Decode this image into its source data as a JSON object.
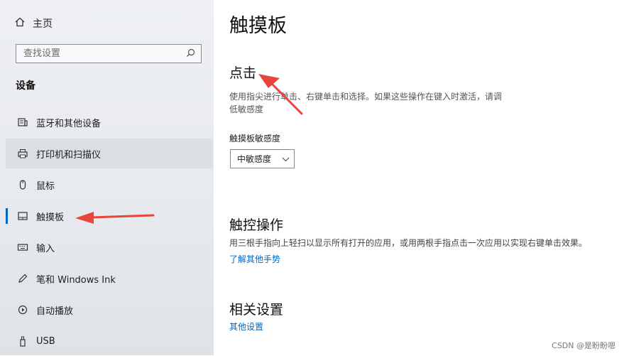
{
  "sidebar": {
    "home_label": "主页",
    "search_placeholder": "查找设置",
    "section_title": "设备",
    "items": [
      {
        "label": "蓝牙和其他设备",
        "icon": "bluetooth-devices-icon"
      },
      {
        "label": "打印机和扫描仪",
        "icon": "printer-icon"
      },
      {
        "label": "鼠标",
        "icon": "mouse-icon"
      },
      {
        "label": "触摸板",
        "icon": "touchpad-icon"
      },
      {
        "label": "输入",
        "icon": "keyboard-icon"
      },
      {
        "label": "笔和 Windows Ink",
        "icon": "pen-icon"
      },
      {
        "label": "自动播放",
        "icon": "autoplay-icon"
      },
      {
        "label": "USB",
        "icon": "usb-icon"
      }
    ]
  },
  "main": {
    "title": "触摸板",
    "tap": {
      "heading": "点击",
      "description_line1": "使用指尖进行单击、右键单击和选择。如果这些操作在键入时激活，请调",
      "description_line2": "低敏感度",
      "sensitivity_label": "触摸板敏感度",
      "sensitivity_value": "中敏感度"
    },
    "gestures": {
      "heading": "触控操作",
      "description": "用三根手指向上轻扫以显示所有打开的应用，或用两根手指点击一次应用以实现右键单击效果。",
      "learn_more": "了解其他手势"
    },
    "related": {
      "heading": "相关设置",
      "other_settings": "其他设置"
    }
  },
  "watermark": "CSDN @是盼盼嗯",
  "colors": {
    "accent": "#0067c0",
    "annotation_arrow": "#e8463c"
  }
}
